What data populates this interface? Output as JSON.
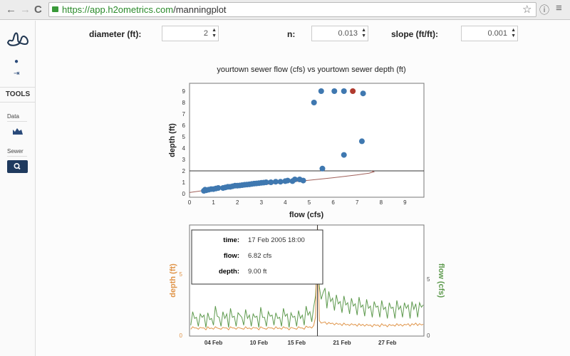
{
  "browser": {
    "url_scheme": "https://",
    "url_host": "app.h2ometrics.com",
    "url_path": "/manningplot"
  },
  "sidebar": {
    "tools_label": "TOOLS",
    "data_label": "Data",
    "sewer_label": "Sewer"
  },
  "inputs": {
    "diameter_label": "diameter (ft):",
    "diameter_value": "2",
    "n_label": "n:",
    "n_value": "0.013",
    "slope_label": "slope (ft/ft):",
    "slope_value": "0.001"
  },
  "chart_data": [
    {
      "type": "scatter",
      "title": "yourtown sewer flow (cfs) vs yourtown sewer depth (ft)",
      "xlabel": "flow (cfs)",
      "ylabel": "depth (ft)",
      "xlim": [
        0,
        9.8
      ],
      "ylim": [
        0,
        9.4
      ],
      "xticks": [
        0,
        1,
        2,
        3,
        4,
        5,
        6,
        7,
        8,
        9
      ],
      "yticks": [
        0,
        1,
        2,
        3,
        4,
        5,
        6,
        7,
        8,
        9
      ],
      "point_color": "#3f78b0",
      "highlight_color": "#b03a2e",
      "curve_color": "#a0605a",
      "points": [
        [
          0.6,
          0.25
        ],
        [
          0.65,
          0.35
        ],
        [
          0.7,
          0.3
        ],
        [
          0.8,
          0.35
        ],
        [
          0.9,
          0.4
        ],
        [
          1.0,
          0.4
        ],
        [
          1.1,
          0.45
        ],
        [
          1.2,
          0.5
        ],
        [
          1.4,
          0.5
        ],
        [
          1.5,
          0.55
        ],
        [
          1.6,
          0.6
        ],
        [
          1.7,
          0.6
        ],
        [
          1.8,
          0.65
        ],
        [
          1.9,
          0.7
        ],
        [
          2.0,
          0.7
        ],
        [
          2.1,
          0.72
        ],
        [
          2.2,
          0.75
        ],
        [
          2.3,
          0.78
        ],
        [
          2.4,
          0.8
        ],
        [
          2.5,
          0.82
        ],
        [
          2.6,
          0.85
        ],
        [
          2.7,
          0.88
        ],
        [
          2.8,
          0.9
        ],
        [
          2.9,
          0.92
        ],
        [
          3.0,
          0.95
        ],
        [
          3.1,
          0.97
        ],
        [
          3.2,
          1.0
        ],
        [
          3.4,
          1.0
        ],
        [
          3.6,
          1.05
        ],
        [
          3.8,
          1.05
        ],
        [
          4.0,
          1.1
        ],
        [
          4.1,
          1.15
        ],
        [
          4.3,
          1.1
        ],
        [
          4.4,
          1.25
        ],
        [
          4.6,
          1.25
        ],
        [
          4.75,
          1.15
        ],
        [
          5.55,
          2.2
        ],
        [
          6.45,
          3.4
        ],
        [
          7.2,
          4.6
        ],
        [
          5.2,
          8.0
        ],
        [
          5.5,
          9.0
        ],
        [
          6.05,
          9.0
        ],
        [
          6.45,
          9.0
        ],
        [
          7.25,
          8.8
        ]
      ],
      "highlight_point": [
        6.82,
        9.0
      ],
      "manning_curve": [
        [
          0,
          0.1
        ],
        [
          0.5,
          0.25
        ],
        [
          1,
          0.38
        ],
        [
          2,
          0.58
        ],
        [
          3,
          0.78
        ],
        [
          4,
          0.98
        ],
        [
          5,
          1.18
        ],
        [
          6,
          1.4
        ],
        [
          7,
          1.65
        ],
        [
          7.5,
          1.8
        ],
        [
          7.7,
          1.92
        ],
        [
          7.6,
          2.0
        ]
      ],
      "diameter_line": 2
    },
    {
      "type": "line",
      "ylabel_left": "depth (ft)",
      "ylabel_right": "flow (cfs)",
      "left_color": "#e0954a",
      "right_color": "#5e9a4e",
      "xlim": [
        "2005-01-31T20:00",
        "2005-03-03T20:00"
      ],
      "ylim_left": [
        0,
        9
      ],
      "ylim_right": [
        0,
        9.8
      ],
      "xticks": [
        "04 Feb",
        "10 Feb",
        "15 Feb",
        "21 Feb",
        "27 Feb"
      ],
      "yticks_left": [
        0,
        5
      ],
      "yticks_right": [
        0,
        5
      ],
      "start": "2005-02-01T00:00",
      "step_hours": 6,
      "cursor": "2005-02-17T18:00",
      "flow": [
        0.9,
        2.1,
        1.5,
        1.6,
        0.8,
        1.9,
        1.6,
        1.8,
        0.7,
        2.0,
        1.4,
        1.5,
        0.9,
        2.6,
        1.7,
        1.6,
        0.8,
        2.1,
        1.5,
        1.9,
        0.7,
        2.4,
        1.6,
        1.7,
        0.8,
        2.0,
        1.8,
        1.6,
        0.9,
        2.3,
        1.5,
        1.8,
        0.8,
        1.9,
        1.6,
        1.7,
        0.7,
        2.5,
        1.6,
        1.6,
        0.8,
        2.1,
        1.7,
        1.8,
        0.9,
        2.0,
        1.5,
        1.6,
        0.8,
        2.4,
        1.7,
        1.9,
        0.7,
        2.0,
        1.6,
        1.7,
        0.8,
        2.2,
        1.5,
        1.8,
        0.9,
        2.6,
        1.8,
        2.1,
        1.2,
        2.5,
        3.5,
        6.82,
        4.3,
        3.2,
        3.8,
        4.2,
        2.4,
        3.9,
        3.0,
        3.3,
        2.2,
        3.6,
        2.8,
        3.0,
        2.0,
        3.5,
        2.7,
        2.9,
        1.9,
        3.3,
        2.6,
        2.8,
        1.8,
        3.4,
        2.5,
        2.7,
        1.7,
        3.2,
        2.4,
        2.6,
        1.6,
        3.0,
        2.5,
        2.6,
        1.6,
        3.1,
        2.3,
        2.5,
        1.5,
        2.9,
        2.4,
        2.5,
        1.5,
        3.1,
        2.3,
        2.6,
        1.6,
        2.9,
        2.4,
        2.7,
        1.5,
        3.0,
        2.3,
        2.8,
        1.6,
        2.9,
        2.5,
        2.7
      ],
      "depth": [
        0.5,
        0.7,
        0.6,
        0.6,
        0.5,
        0.65,
        0.6,
        0.6,
        0.45,
        0.7,
        0.55,
        0.6,
        0.5,
        0.7,
        0.6,
        0.55,
        0.5,
        0.65,
        0.6,
        0.6,
        0.45,
        0.7,
        0.6,
        0.6,
        0.5,
        0.65,
        0.6,
        0.55,
        0.5,
        0.7,
        0.55,
        0.6,
        0.5,
        0.65,
        0.6,
        0.6,
        0.45,
        0.7,
        0.6,
        0.55,
        0.5,
        0.65,
        0.6,
        0.6,
        0.5,
        0.7,
        0.55,
        0.6,
        0.5,
        0.7,
        0.6,
        0.6,
        0.45,
        0.65,
        0.6,
        0.55,
        0.5,
        0.7,
        0.6,
        0.6,
        0.5,
        0.75,
        0.65,
        0.7,
        0.6,
        0.8,
        1.5,
        9.0,
        1.2,
        1.0,
        1.05,
        1.1,
        0.9,
        1.05,
        0.95,
        1.0,
        0.85,
        1.0,
        0.9,
        0.95,
        0.8,
        1.0,
        0.85,
        0.9,
        0.8,
        0.95,
        0.85,
        0.9,
        0.75,
        0.95,
        0.8,
        0.9,
        0.75,
        0.9,
        0.8,
        0.85,
        0.7,
        0.9,
        0.8,
        0.85,
        0.7,
        0.95,
        0.8,
        0.85,
        0.7,
        0.9,
        0.8,
        0.85,
        0.75,
        0.95,
        0.8,
        0.9,
        0.75,
        0.9,
        0.85,
        0.95,
        0.75,
        0.95,
        0.85,
        1.0,
        0.8,
        0.95,
        0.85,
        0.9
      ],
      "tooltip": {
        "time_label": "time:",
        "time_value": "17 Feb 2005 18:00",
        "flow_label": "flow:",
        "flow_value": "6.82 cfs",
        "depth_label": "depth:",
        "depth_value": "9.00 ft"
      }
    }
  ]
}
